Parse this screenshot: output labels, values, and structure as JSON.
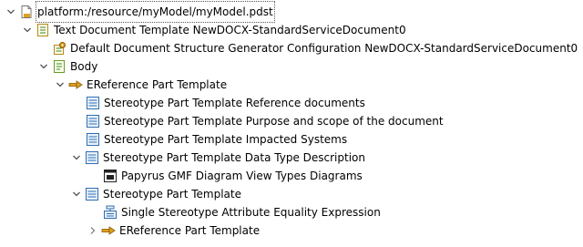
{
  "tree": {
    "items": [
      {
        "label": "platform:/resource/myModel/myModel.pdst",
        "icon": "file-icon",
        "expanded": true
      },
      {
        "label": "Text Document Template NewDOCX-StandardServiceDocument0",
        "icon": "document-template-icon",
        "expanded": true
      },
      {
        "label": "Default Document Structure Generator Configuration NewDOCX-StandardServiceDocument0",
        "icon": "generator-config-icon"
      },
      {
        "label": "Body",
        "icon": "body-icon",
        "expanded": true
      },
      {
        "label": "EReference Part Template",
        "icon": "ereference-arrow-icon",
        "expanded": true
      },
      {
        "label": "Stereotype Part Template Reference documents",
        "icon": "stereotype-part-icon"
      },
      {
        "label": "Stereotype Part Template Purpose and scope of the document",
        "icon": "stereotype-part-icon"
      },
      {
        "label": "Stereotype Part Template Impacted Systems",
        "icon": "stereotype-part-icon"
      },
      {
        "label": "Stereotype Part Template Data Type Description",
        "icon": "stereotype-part-icon",
        "expanded": true
      },
      {
        "label": "Papyrus GMF Diagram View Types Diagrams",
        "icon": "diagram-icon"
      },
      {
        "label": "Stereotype Part Template",
        "icon": "stereotype-part-icon",
        "expanded": true
      },
      {
        "label": "Single Stereotype Attribute Equality Expression",
        "icon": "equality-expression-icon"
      },
      {
        "label": "EReference Part Template",
        "icon": "ereference-arrow-icon",
        "expanded": false
      }
    ]
  },
  "colors": {
    "twisty": "#555555",
    "icon_blue": "#2f6db0",
    "icon_green": "#3c8a2e",
    "icon_orange": "#e0a020"
  }
}
